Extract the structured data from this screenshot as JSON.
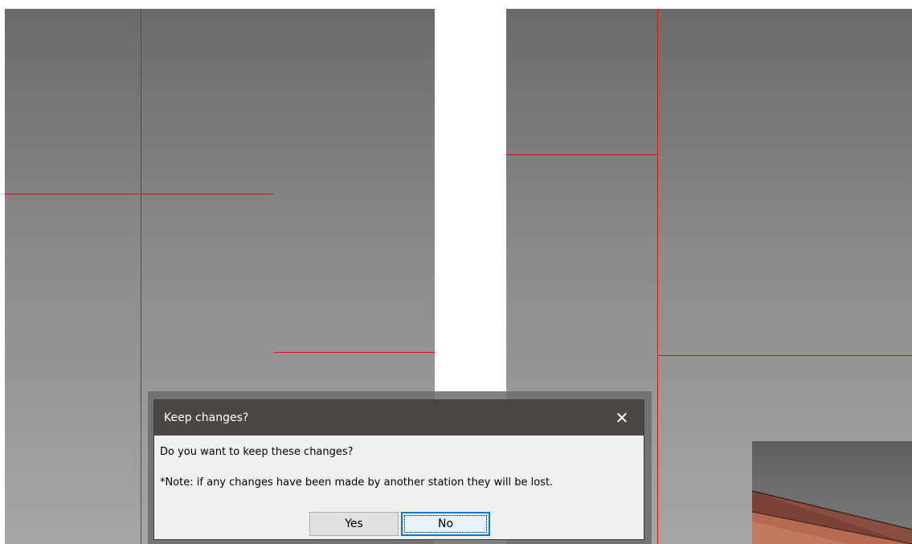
{
  "dialog": {
    "title": "Keep changes?",
    "close_icon": "close-icon",
    "message": "Do you want to keep these changes?",
    "note": "*Note: if any changes have been made by another station they will be lost.",
    "yes_label": "Yes",
    "no_label": "No",
    "default_button": "No"
  },
  "colors": {
    "titlebar_bg": "#494643",
    "dialog_bg": "#f0f0f0",
    "grid_line": "#e01010",
    "focus_border": "#0078d7",
    "model_surface": "#7a4236"
  }
}
